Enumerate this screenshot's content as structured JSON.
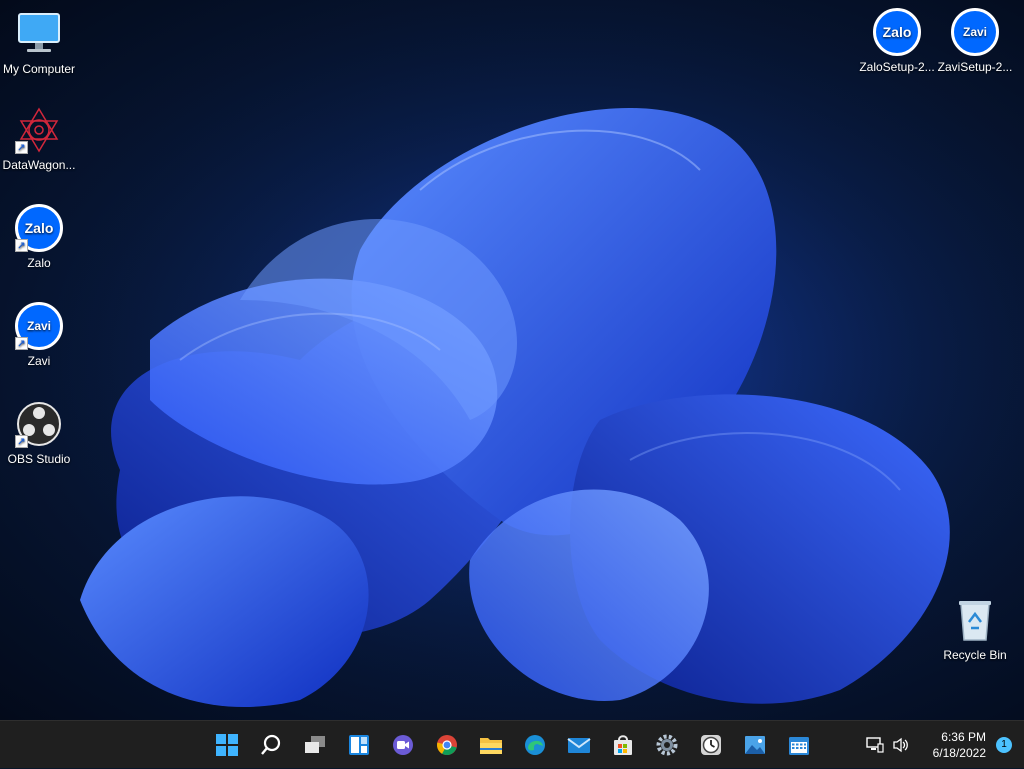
{
  "desktop": {
    "icons": [
      {
        "label": "My Computer",
        "icon": "monitor-icon"
      },
      {
        "label": "DataWagon...",
        "icon": "datawagon-icon"
      },
      {
        "label": "Zalo",
        "icon": "zalo-icon",
        "badge": "Zalo"
      },
      {
        "label": "Zavi",
        "icon": "zavi-icon",
        "badge": "Zavi"
      },
      {
        "label": "OBS Studio",
        "icon": "obs-icon"
      },
      {
        "label": "ZaloSetup-2...",
        "icon": "zalo-setup-icon",
        "badge": "Zalo"
      },
      {
        "label": "ZaviSetup-2...",
        "icon": "zavi-setup-icon",
        "badge": "Zavi"
      },
      {
        "label": "Recycle Bin",
        "icon": "recycle-bin-icon"
      }
    ]
  },
  "taskbar": {
    "pinned": [
      "start-icon",
      "search-icon",
      "task-view-icon",
      "widgets-icon",
      "chat-icon",
      "chrome-icon",
      "file-explorer-icon",
      "edge-icon",
      "mail-icon",
      "store-icon",
      "settings-icon",
      "clock-app-icon",
      "photos-icon",
      "calendar-icon"
    ],
    "tray": {
      "time": "6:36 PM",
      "date": "6/18/2022",
      "notification_count": "1",
      "icons": [
        "network-icon",
        "volume-icon"
      ]
    }
  },
  "colors": {
    "accent": "#1c5fd4",
    "taskbar": "#1f1f1f",
    "zalo_blue": "#0068ff"
  }
}
